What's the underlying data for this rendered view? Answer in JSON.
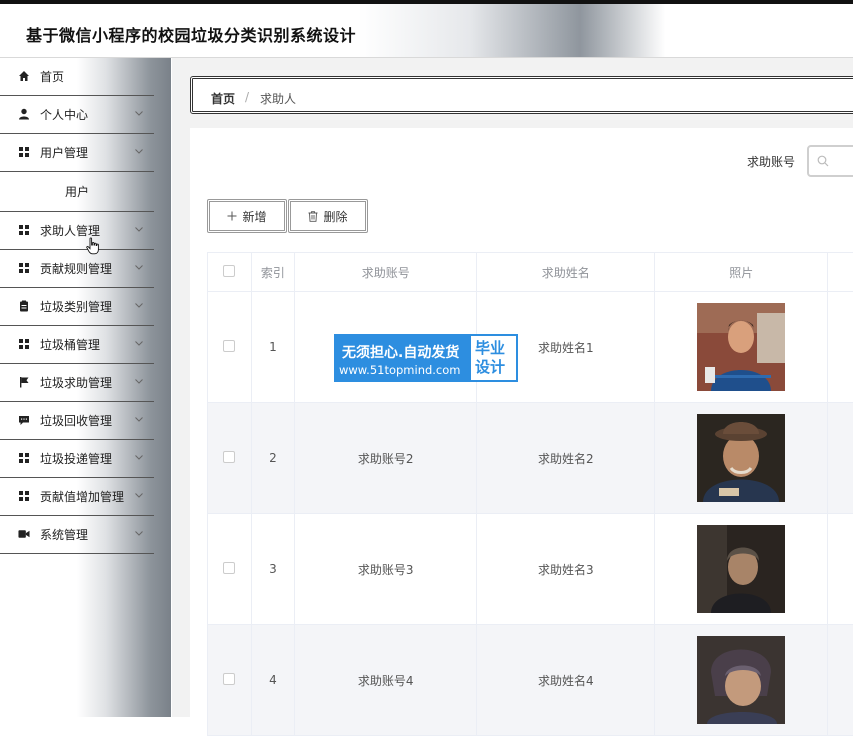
{
  "app": {
    "title": "基于微信小程序的校园垃圾分类识别系统设计"
  },
  "sidebar": {
    "items": [
      {
        "label": "首页",
        "icon": "home-icon",
        "chevron": false
      },
      {
        "label": "个人中心",
        "icon": "person-icon",
        "chevron": true
      },
      {
        "label": "用户管理",
        "icon": "grid-icon",
        "chevron": true
      },
      {
        "label": "用户",
        "icon": "",
        "chevron": false,
        "sub": true
      },
      {
        "label": "求助人管理",
        "icon": "grid-icon",
        "chevron": true
      },
      {
        "label": "贡献规则管理",
        "icon": "grid-icon",
        "chevron": true
      },
      {
        "label": "垃圾类别管理",
        "icon": "clipboard-icon",
        "chevron": true
      },
      {
        "label": "垃圾桶管理",
        "icon": "grid-icon",
        "chevron": true
      },
      {
        "label": "垃圾求助管理",
        "icon": "flag-icon",
        "chevron": true
      },
      {
        "label": "垃圾回收管理",
        "icon": "chat-icon",
        "chevron": true
      },
      {
        "label": "垃圾投递管理",
        "icon": "grid-icon",
        "chevron": true
      },
      {
        "label": "贡献值增加管理",
        "icon": "grid-icon",
        "chevron": true
      },
      {
        "label": "系统管理",
        "icon": "settings-icon",
        "chevron": true
      }
    ]
  },
  "breadcrumb": {
    "home": "首页",
    "separator": "/",
    "current": "求助人"
  },
  "search": {
    "label": "求助账号",
    "value": "",
    "placeholder": ""
  },
  "toolbar": {
    "add_label": "新增",
    "delete_label": "删除"
  },
  "table": {
    "headers": [
      "索引",
      "求助账号",
      "求助姓名",
      "照片"
    ],
    "rows": [
      {
        "index": "1",
        "account": "",
        "name": "求助姓名1"
      },
      {
        "index": "2",
        "account": "求助账号2",
        "name": "求助姓名2"
      },
      {
        "index": "3",
        "account": "求助账号3",
        "name": "求助姓名3"
      },
      {
        "index": "4",
        "account": "求助账号4",
        "name": "求助姓名4"
      }
    ]
  },
  "watermark": {
    "line1": "无须担心.自动发货",
    "line2": "www.51topmind.com",
    "right": "毕业设计"
  },
  "colors": {
    "watermark_blue": "#2d8ee0",
    "row_alt": "#f4f5f8",
    "header_text": "#909399"
  }
}
